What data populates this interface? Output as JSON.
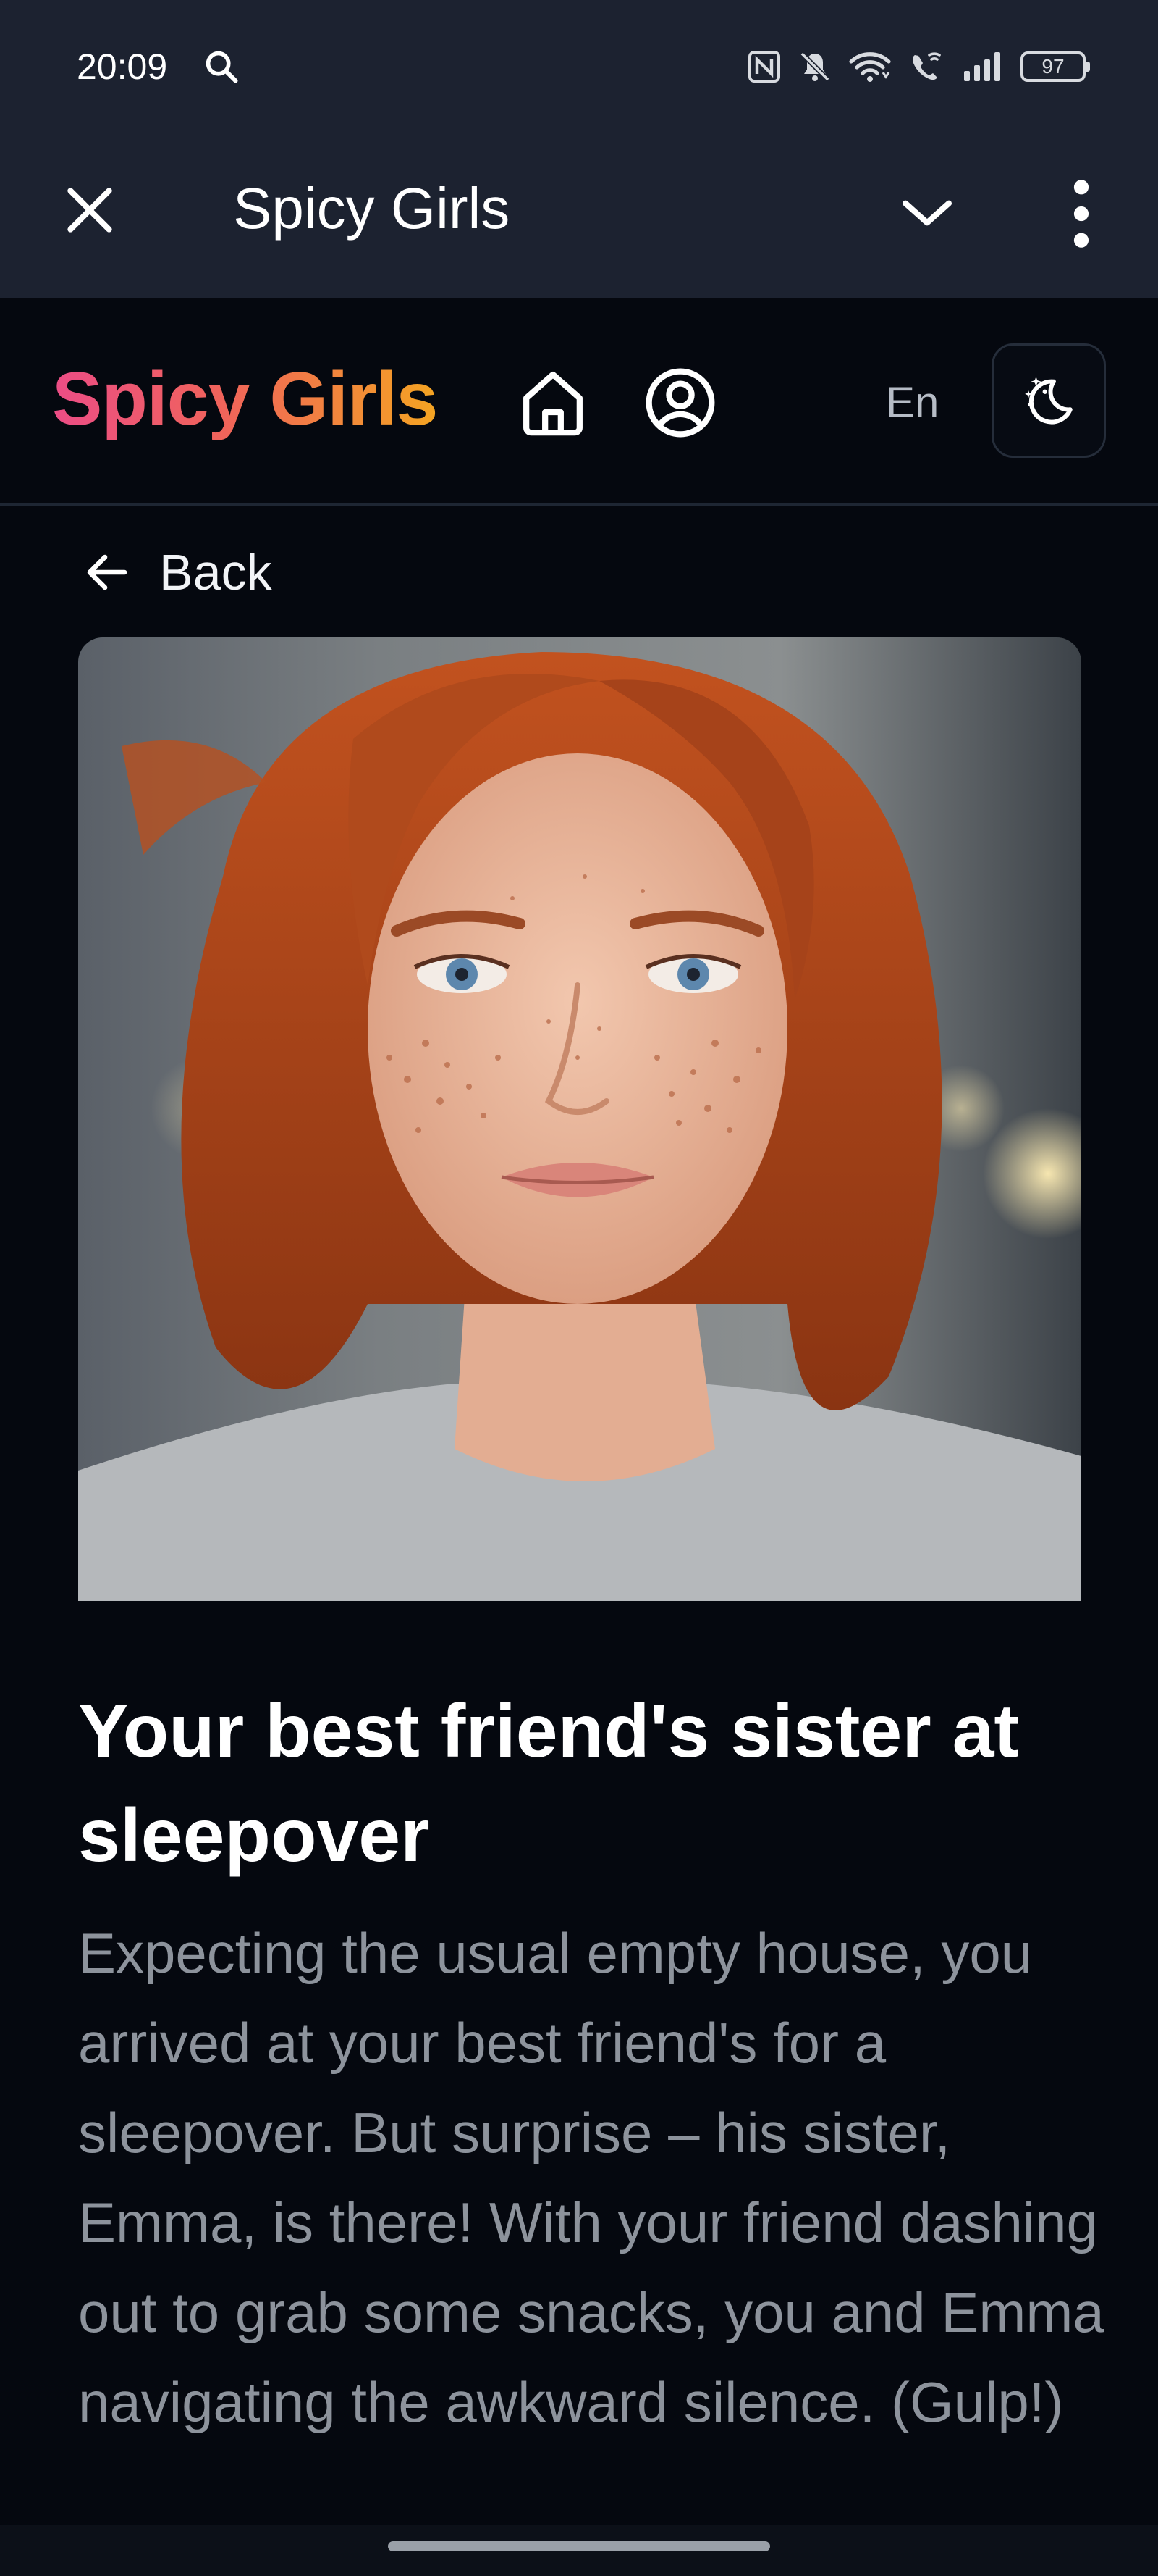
{
  "status_bar": {
    "time": "20:09",
    "battery_level": "97",
    "icons": [
      "search-icon",
      "nfc-icon",
      "mute-icon",
      "wifi-icon",
      "wifi-calling-icon",
      "signal-icon",
      "battery-icon"
    ]
  },
  "browser_toolbar": {
    "title": "Spicy Girls",
    "icons": [
      "close-icon",
      "chevron-down-icon",
      "more-vert-icon"
    ]
  },
  "site_header": {
    "logo": "Spicy Girls",
    "language": "En",
    "icons": [
      "home-icon",
      "user-icon",
      "moon-stars-icon"
    ],
    "logo_gradient": [
      "#ec4d86",
      "#f0645a",
      "#f4a422"
    ]
  },
  "back_link": {
    "label": "Back"
  },
  "story": {
    "title": "Your best friend's sister at sleepover",
    "description": "Expecting the usual empty house, you arrived at your best friend's for a sleepover. But surprise – his sister, Emma, is there! With your friend dashing out to grab some snacks, you and Emma navigating the awkward silence. (Gulp!)"
  },
  "colors": {
    "background": "#05080f",
    "toolbar": "#1c2230",
    "text_muted": "#8d939c"
  }
}
